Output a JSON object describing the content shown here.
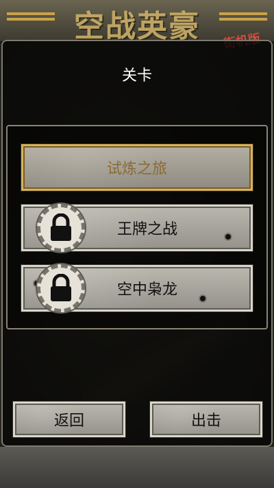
{
  "background": {
    "game_title": "空战英豪",
    "game_subtitle": "街机版"
  },
  "dialog": {
    "title": "关卡"
  },
  "levels": [
    {
      "label": "试炼之旅",
      "locked": false,
      "selected": true
    },
    {
      "label": "王牌之战",
      "locked": true,
      "selected": false,
      "icon": "lock-icon"
    },
    {
      "label": "空中枭龙",
      "locked": true,
      "selected": false,
      "icon": "lock-icon"
    }
  ],
  "buttons": {
    "back_label": "返回",
    "fight_label": "出击"
  },
  "colors": {
    "selected_border": "#d8b25c",
    "selected_text": "#8a6a36",
    "stone": "#a9a79e"
  }
}
